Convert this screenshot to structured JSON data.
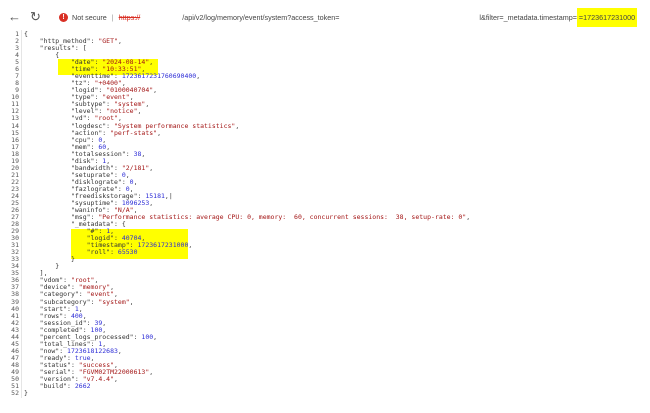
{
  "browser": {
    "back_icon": "arrow-left",
    "reload_icon": "reload",
    "security_label": "Not secure",
    "url_scheme": "https://",
    "url_path": "/api/v2/log/memory/event/system?access_token=",
    "url_filter": "l&filter=_metadata.timestamp=",
    "url_timestamp": "=1723617231000"
  },
  "code": {
    "lines": [
      [
        [
          "{",
          "p"
        ]
      ],
      [
        [
          "    \"http_method\": ",
          "k"
        ],
        [
          "\"GET\"",
          "s"
        ],
        [
          ",",
          "p"
        ]
      ],
      [
        [
          "    \"results\": [",
          "k"
        ]
      ],
      [
        [
          "        {",
          "p"
        ]
      ],
      [
        [
          "            \"date\": ",
          "k"
        ],
        [
          "\"2024-08-14\"",
          "s"
        ],
        [
          ",",
          "p"
        ]
      ],
      [
        [
          "            \"time\": ",
          "k"
        ],
        [
          "\"10:33:51\"",
          "s"
        ],
        [
          ",",
          "p"
        ]
      ],
      [
        [
          "            \"eventtime\": ",
          "k"
        ],
        [
          "1723617231760690400",
          "n"
        ],
        [
          ",",
          "p"
        ]
      ],
      [
        [
          "            \"tz\": ",
          "k"
        ],
        [
          "\"+0400\"",
          "s"
        ],
        [
          ",",
          "p"
        ]
      ],
      [
        [
          "            \"logid\": ",
          "k"
        ],
        [
          "\"0100040704\"",
          "s"
        ],
        [
          ",",
          "p"
        ]
      ],
      [
        [
          "            \"type\": ",
          "k"
        ],
        [
          "\"event\"",
          "s"
        ],
        [
          ",",
          "p"
        ]
      ],
      [
        [
          "            \"subtype\": ",
          "k"
        ],
        [
          "\"system\"",
          "s"
        ],
        [
          ",",
          "p"
        ]
      ],
      [
        [
          "            \"level\": ",
          "k"
        ],
        [
          "\"notice\"",
          "s"
        ],
        [
          ",",
          "p"
        ]
      ],
      [
        [
          "            \"vd\": ",
          "k"
        ],
        [
          "\"root\"",
          "s"
        ],
        [
          ",",
          "p"
        ]
      ],
      [
        [
          "            \"logdesc\": ",
          "k"
        ],
        [
          "\"System performance statistics\"",
          "s"
        ],
        [
          ",",
          "p"
        ]
      ],
      [
        [
          "            \"action\": ",
          "k"
        ],
        [
          "\"perf-stats\"",
          "s"
        ],
        [
          ",",
          "p"
        ]
      ],
      [
        [
          "            \"cpu\": ",
          "k"
        ],
        [
          "0",
          "n"
        ],
        [
          ",",
          "p"
        ]
      ],
      [
        [
          "            \"mem\": ",
          "k"
        ],
        [
          "60",
          "n"
        ],
        [
          ",",
          "p"
        ]
      ],
      [
        [
          "            \"totalsession\": ",
          "k"
        ],
        [
          "38",
          "n"
        ],
        [
          ",",
          "p"
        ]
      ],
      [
        [
          "            \"disk\": ",
          "k"
        ],
        [
          "1",
          "n"
        ],
        [
          ",",
          "p"
        ]
      ],
      [
        [
          "            \"bandwidth\": ",
          "k"
        ],
        [
          "\"2/181\"",
          "s"
        ],
        [
          ",",
          "p"
        ]
      ],
      [
        [
          "            \"setuprate\": ",
          "k"
        ],
        [
          "0",
          "n"
        ],
        [
          ",",
          "p"
        ]
      ],
      [
        [
          "            \"disklograte\": ",
          "k"
        ],
        [
          "0",
          "n"
        ],
        [
          ",",
          "p"
        ]
      ],
      [
        [
          "            \"fazlograte\": ",
          "k"
        ],
        [
          "0",
          "n"
        ],
        [
          ",",
          "p"
        ]
      ],
      [
        [
          "            \"freediskstorage\": ",
          "k"
        ],
        [
          "15181",
          "n"
        ],
        [
          ",|",
          "p"
        ]
      ],
      [
        [
          "            \"sysuptime\": ",
          "k"
        ],
        [
          "1096253",
          "n"
        ],
        [
          ",",
          "p"
        ]
      ],
      [
        [
          "            \"waninfo\": ",
          "k"
        ],
        [
          "\"N/A\"",
          "s"
        ],
        [
          ",",
          "p"
        ]
      ],
      [
        [
          "            \"msg\": ",
          "k"
        ],
        [
          "\"Performance statistics: average CPU: 0, memory:  60, concurrent sessions:  38, setup-rate: 0\"",
          "s"
        ],
        [
          ",",
          "p"
        ]
      ],
      [
        [
          "            \"_metadata\": {",
          "k"
        ]
      ],
      [
        [
          "                \"#\": ",
          "k"
        ],
        [
          "1",
          "n"
        ],
        [
          ",",
          "p"
        ]
      ],
      [
        [
          "                \"logid\": ",
          "k"
        ],
        [
          "40704",
          "n"
        ],
        [
          ",",
          "p"
        ]
      ],
      [
        [
          "                \"timestamp\": ",
          "k"
        ],
        [
          "1723617231000",
          "n"
        ],
        [
          ",",
          "p"
        ]
      ],
      [
        [
          "                \"roll\": ",
          "k"
        ],
        [
          "65530",
          "n"
        ]
      ],
      [
        [
          "            }",
          "p"
        ]
      ],
      [
        [
          "        }",
          "p"
        ]
      ],
      [
        [
          "    ],",
          "p"
        ]
      ],
      [
        [
          "    \"vdom\": ",
          "k"
        ],
        [
          "\"root\"",
          "s"
        ],
        [
          ",",
          "p"
        ]
      ],
      [
        [
          "    \"device\": ",
          "k"
        ],
        [
          "\"memory\"",
          "s"
        ],
        [
          ",",
          "p"
        ]
      ],
      [
        [
          "    \"category\": ",
          "k"
        ],
        [
          "\"event\"",
          "s"
        ],
        [
          ",",
          "p"
        ]
      ],
      [
        [
          "    \"subcategory\": ",
          "k"
        ],
        [
          "\"system\"",
          "s"
        ],
        [
          ",",
          "p"
        ]
      ],
      [
        [
          "    \"start\": ",
          "k"
        ],
        [
          "1",
          "n"
        ],
        [
          ",",
          "p"
        ]
      ],
      [
        [
          "    \"rows\": ",
          "k"
        ],
        [
          "400",
          "n"
        ],
        [
          ",",
          "p"
        ]
      ],
      [
        [
          "    \"session_id\": ",
          "k"
        ],
        [
          "39",
          "n"
        ],
        [
          ",",
          "p"
        ]
      ],
      [
        [
          "    \"completed\": ",
          "k"
        ],
        [
          "100",
          "n"
        ],
        [
          ",",
          "p"
        ]
      ],
      [
        [
          "    \"percent_logs_processed\": ",
          "k"
        ],
        [
          "100",
          "n"
        ],
        [
          ",",
          "p"
        ]
      ],
      [
        [
          "    \"total_lines\": ",
          "k"
        ],
        [
          "1",
          "n"
        ],
        [
          ",",
          "p"
        ]
      ],
      [
        [
          "    \"now\": ",
          "k"
        ],
        [
          "1723618122683",
          "n"
        ],
        [
          ",",
          "p"
        ]
      ],
      [
        [
          "    \"ready\": ",
          "k"
        ],
        [
          "true",
          "n"
        ],
        [
          ",",
          "p"
        ]
      ],
      [
        [
          "    \"status\": ",
          "k"
        ],
        [
          "\"success\"",
          "s"
        ],
        [
          ",",
          "p"
        ]
      ],
      [
        [
          "    \"serial\": ",
          "k"
        ],
        [
          "\"FGVM02TM22000613\"",
          "s"
        ],
        [
          ",",
          "p"
        ]
      ],
      [
        [
          "    \"version\": ",
          "k"
        ],
        [
          "\"v7.4.4\"",
          "s"
        ],
        [
          ",",
          "p"
        ]
      ],
      [
        [
          "    \"build\": ",
          "k"
        ],
        [
          "2662",
          "n"
        ]
      ],
      [
        [
          "}",
          "p"
        ]
      ]
    ]
  }
}
